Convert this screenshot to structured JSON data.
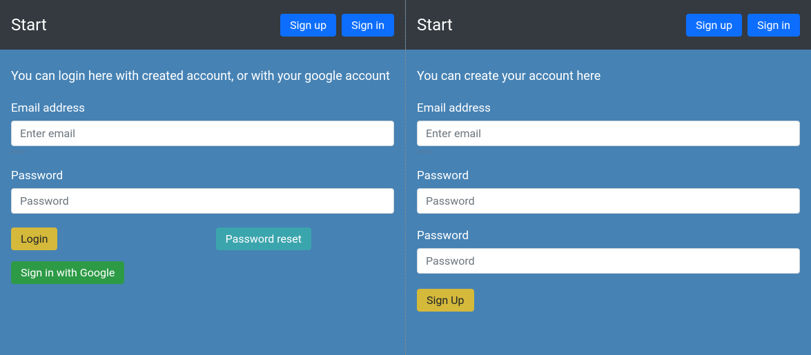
{
  "left": {
    "nav": {
      "brand": "Start",
      "signup": "Sign up",
      "signin": "Sign in"
    },
    "intro": "You can login here with created account, or with your google account",
    "email_label": "Email address",
    "email_placeholder": "Enter email",
    "email_value": "",
    "email_help": "email",
    "password_label": "Password",
    "password_placeholder": "Password",
    "password_value": "",
    "login_btn": "Login",
    "reset_btn": "Password reset",
    "google_btn": "Sign in with Google"
  },
  "right": {
    "nav": {
      "brand": "Start",
      "signup": "Sign up",
      "signin": "Sign in"
    },
    "intro": "You can create your account here",
    "email_label": "Email address",
    "email_placeholder": "Enter email",
    "email_value": "",
    "email_help": "email",
    "password1_label": "Password",
    "password1_placeholder": "Password",
    "password1_value": "",
    "password2_label": "Password",
    "password2_placeholder": "Password",
    "password2_value": "",
    "signup_btn": "Sign Up"
  }
}
